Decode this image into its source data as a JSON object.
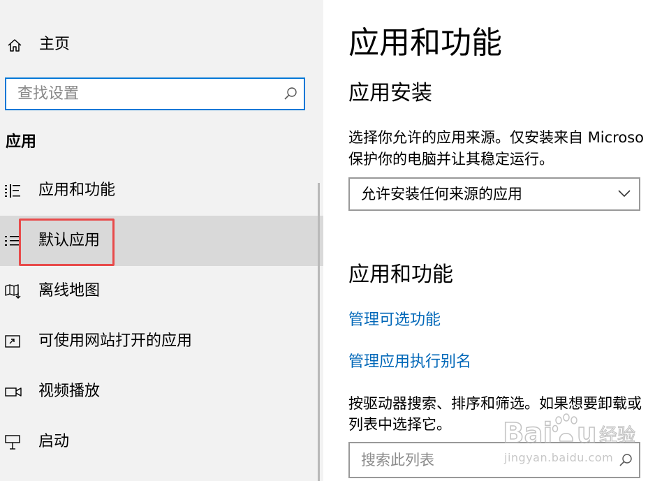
{
  "sidebar": {
    "home_label": "主页",
    "search_placeholder": "查找设置",
    "section_title": "应用",
    "items": [
      {
        "label": "应用和功能",
        "icon": "apps-features-list-icon"
      },
      {
        "label": "默认应用",
        "icon": "default-apps-icon",
        "selected": true
      },
      {
        "label": "离线地图",
        "icon": "offline-maps-icon"
      },
      {
        "label": "可使用网站打开的应用",
        "icon": "apps-for-websites-icon"
      },
      {
        "label": "视频播放",
        "icon": "video-playback-icon"
      },
      {
        "label": "启动",
        "icon": "startup-icon"
      }
    ]
  },
  "main": {
    "title": "应用和功能",
    "install_section": {
      "heading": "应用安装",
      "description_line1": "选择你允许的应用来源。仅安装来自 Microso",
      "description_line2": "保护你的电脑并让其稳定运行。",
      "dropdown_value": "允许安装任何来源的应用"
    },
    "features_section": {
      "heading": "应用和功能",
      "link_optional_features": "管理可选功能",
      "link_execution_aliases": "管理应用执行别名",
      "description_line1": "按驱动器搜索、排序和筛选。如果想要卸载或",
      "description_line2": "列表中选择它。",
      "search_placeholder": "搜索此列表"
    }
  },
  "watermark": {
    "url": "jingyan.baidu.com"
  },
  "colors": {
    "sidebar_bg": "#f2f2f2",
    "selected_bg": "#d9d9d9",
    "accent": "#0078d7",
    "link": "#0067b8",
    "highlight_box": "#e84a4a"
  }
}
